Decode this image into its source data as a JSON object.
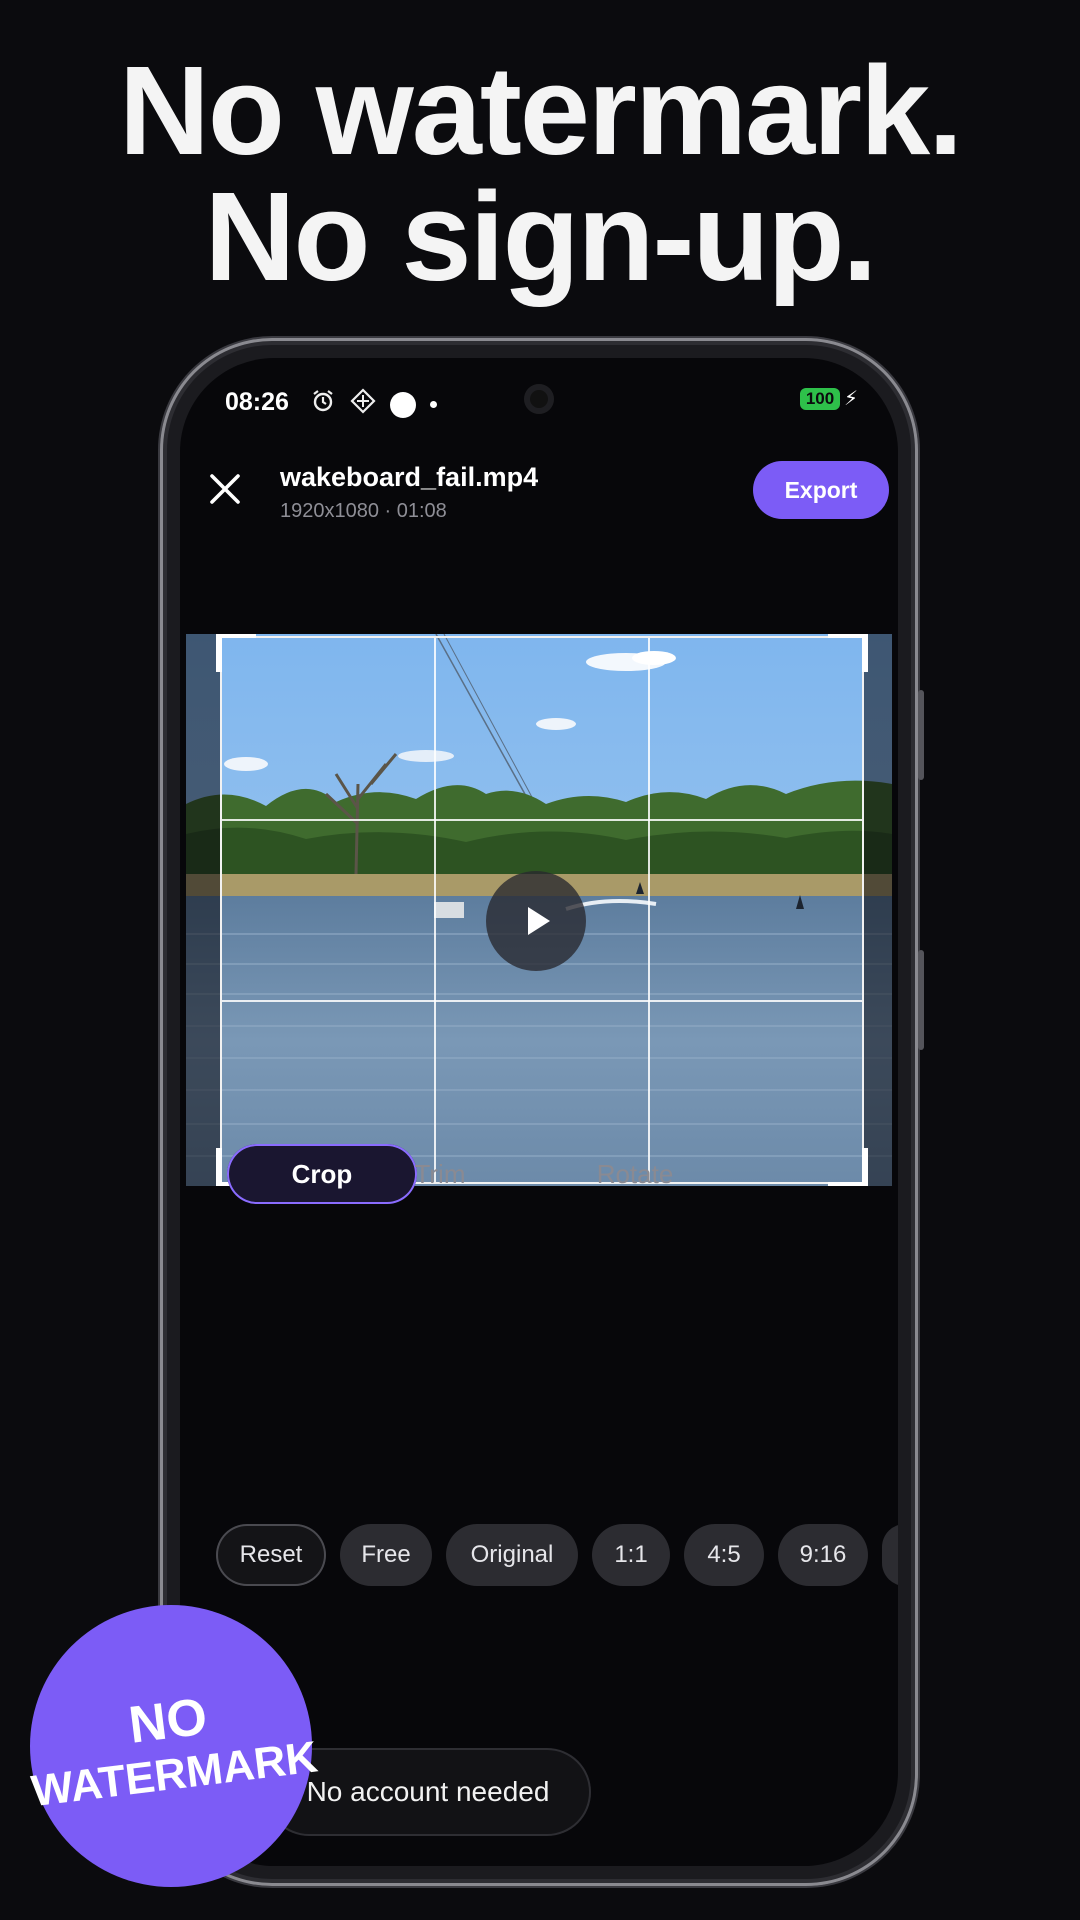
{
  "headline": {
    "line1": "No watermark.",
    "line2": "No sign-up."
  },
  "status_bar": {
    "time": "08:26",
    "battery": "100"
  },
  "header": {
    "file_name": "wakeboard_fail.mp4",
    "file_meta": "1920x1080 · 01:08",
    "export_label": "Export"
  },
  "tabs": [
    {
      "label": "Crop",
      "active": true
    },
    {
      "label": "Trim",
      "active": false
    },
    {
      "label": "Rotate",
      "active": false
    }
  ],
  "aspect_options": [
    "Reset",
    "Free",
    "Original",
    "1:1",
    "4:5",
    "9:16"
  ],
  "toast": "No account needed",
  "badge": {
    "line1": "NO",
    "line2": "WATERMARK"
  },
  "colors": {
    "accent": "#7c5cf6",
    "background": "#0b0b0e",
    "battery": "#2ec04a"
  }
}
